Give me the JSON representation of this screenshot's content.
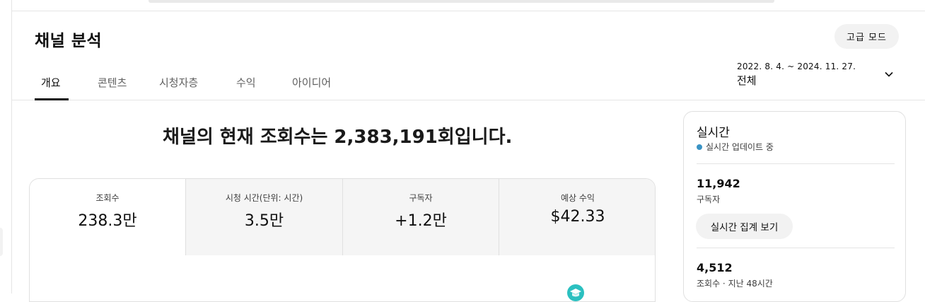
{
  "page": {
    "title": "채널 분석",
    "advanced_mode_label": "고급 모드"
  },
  "tabs": [
    {
      "label": "개요",
      "active": true
    },
    {
      "label": "콘텐츠",
      "active": false
    },
    {
      "label": "시청자층",
      "active": false
    },
    {
      "label": "수익",
      "active": false
    },
    {
      "label": "아이디어",
      "active": false
    }
  ],
  "date_filter": {
    "range": "2022. 8. 4. ~ 2024. 11. 27.",
    "label": "전체"
  },
  "headline": "채널의 현재 조회수는 2,383,191회입니다.",
  "metrics": [
    {
      "label": "조회수",
      "value": "238.3만"
    },
    {
      "label": "시청 시간(단위: 시간)",
      "value": "3.5만"
    },
    {
      "label": "구독자",
      "value": "+1.2만"
    },
    {
      "label": "예상 수익",
      "value": "$42.33"
    }
  ],
  "realtime": {
    "title": "실시간",
    "status": "실시간 업데이트 중",
    "subscribers_value": "11,942",
    "subscribers_label": "구독자",
    "view_button": "실시간 집계 보기",
    "views_value": "4,512",
    "views_label": "조회수 · 지난 48시간"
  },
  "colors": {
    "status_dot": "#3a93c4",
    "tab_active": "#0f0f0f",
    "tab_inactive": "#606060"
  },
  "icons": {
    "date_dropdown": "chevron-down-icon",
    "status": "live-dot-icon"
  }
}
